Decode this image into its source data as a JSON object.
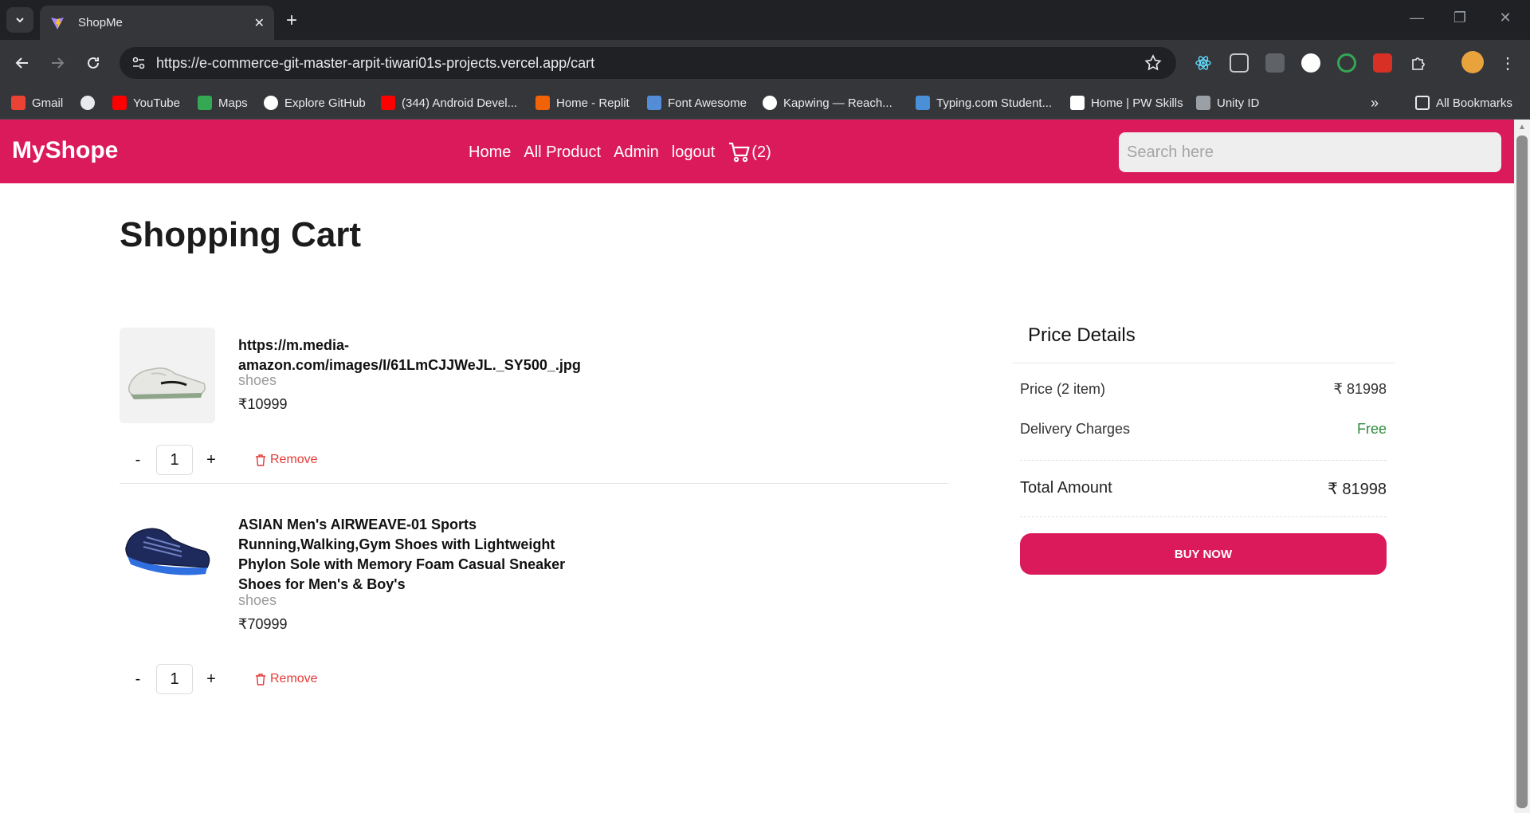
{
  "browser": {
    "tab_title": "ShopMe",
    "url": "https://e-commerce-git-master-arpit-tiwari01s-projects.vercel.app/cart",
    "bookmarks": [
      "Gmail",
      "YouTube",
      "Maps",
      "Explore GitHub",
      "(344) Android Devel...",
      "Home - Replit",
      "Font Awesome",
      "Kapwing — Reach...",
      "Typing.com Student...",
      "Home | PW Skills",
      "Unity ID"
    ],
    "all_bookmarks": "All Bookmarks"
  },
  "navbar": {
    "brand": "MyShope",
    "links": [
      "Home",
      "All Product",
      "Admin",
      "logout"
    ],
    "cart_count": "(2)",
    "search_placeholder": "Search here",
    "accent": "#db1a5c"
  },
  "cart": {
    "heading": "Shopping Cart",
    "items": [
      {
        "name": "https://m.media-amazon.com/images/I/61LmCJJWeJL._SY500_.jpg",
        "category": "shoes",
        "price": "₹10999",
        "quantity": "1",
        "minus": "-",
        "plus": "+",
        "remove": "Remove"
      },
      {
        "name": "ASIAN Men's AIRWEAVE-01 Sports Running,Walking,Gym Shoes with Lightweight Phylon Sole with Memory Foam Casual Sneaker Shoes for Men's & Boy's",
        "category": "shoes",
        "price": "₹70999",
        "quantity": "1",
        "minus": "-",
        "plus": "+",
        "remove": "Remove"
      }
    ]
  },
  "price_details": {
    "title": "Price Details",
    "price_label": "Price (2 item)",
    "price_value": "₹ 81998",
    "delivery_label": "Delivery Charges",
    "delivery_value": "Free",
    "total_label": "Total Amount",
    "total_value": "₹ 81998",
    "buy_label": "BUY NOW"
  }
}
